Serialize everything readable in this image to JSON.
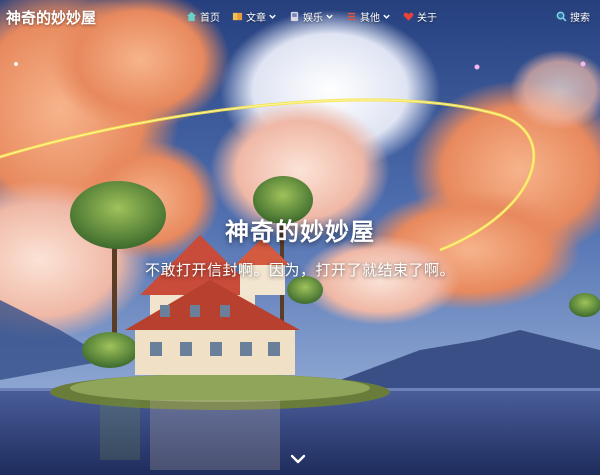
{
  "site": {
    "name": "神奇的妙妙屋"
  },
  "nav": {
    "items": [
      {
        "label": "首页",
        "icon": "home-icon",
        "has_dropdown": false
      },
      {
        "label": "文章",
        "icon": "book-icon",
        "has_dropdown": true
      },
      {
        "label": "娱乐",
        "icon": "game-icon",
        "has_dropdown": true
      },
      {
        "label": "其他",
        "icon": "list-icon",
        "has_dropdown": true
      },
      {
        "label": "关于",
        "icon": "heart-icon",
        "has_dropdown": false
      }
    ],
    "search_label": "搜索"
  },
  "hero": {
    "title": "神奇的妙妙屋",
    "subtitle": "不敢打开信封啊。因为，打开了就结束了啊。"
  },
  "colors": {
    "sky_top": "#2f4a8f",
    "cloud_orange": "#e98a5c",
    "cloud_pink": "#f3b7a6",
    "glow_ring": "#f5e34a",
    "water": "#2b3f78"
  }
}
